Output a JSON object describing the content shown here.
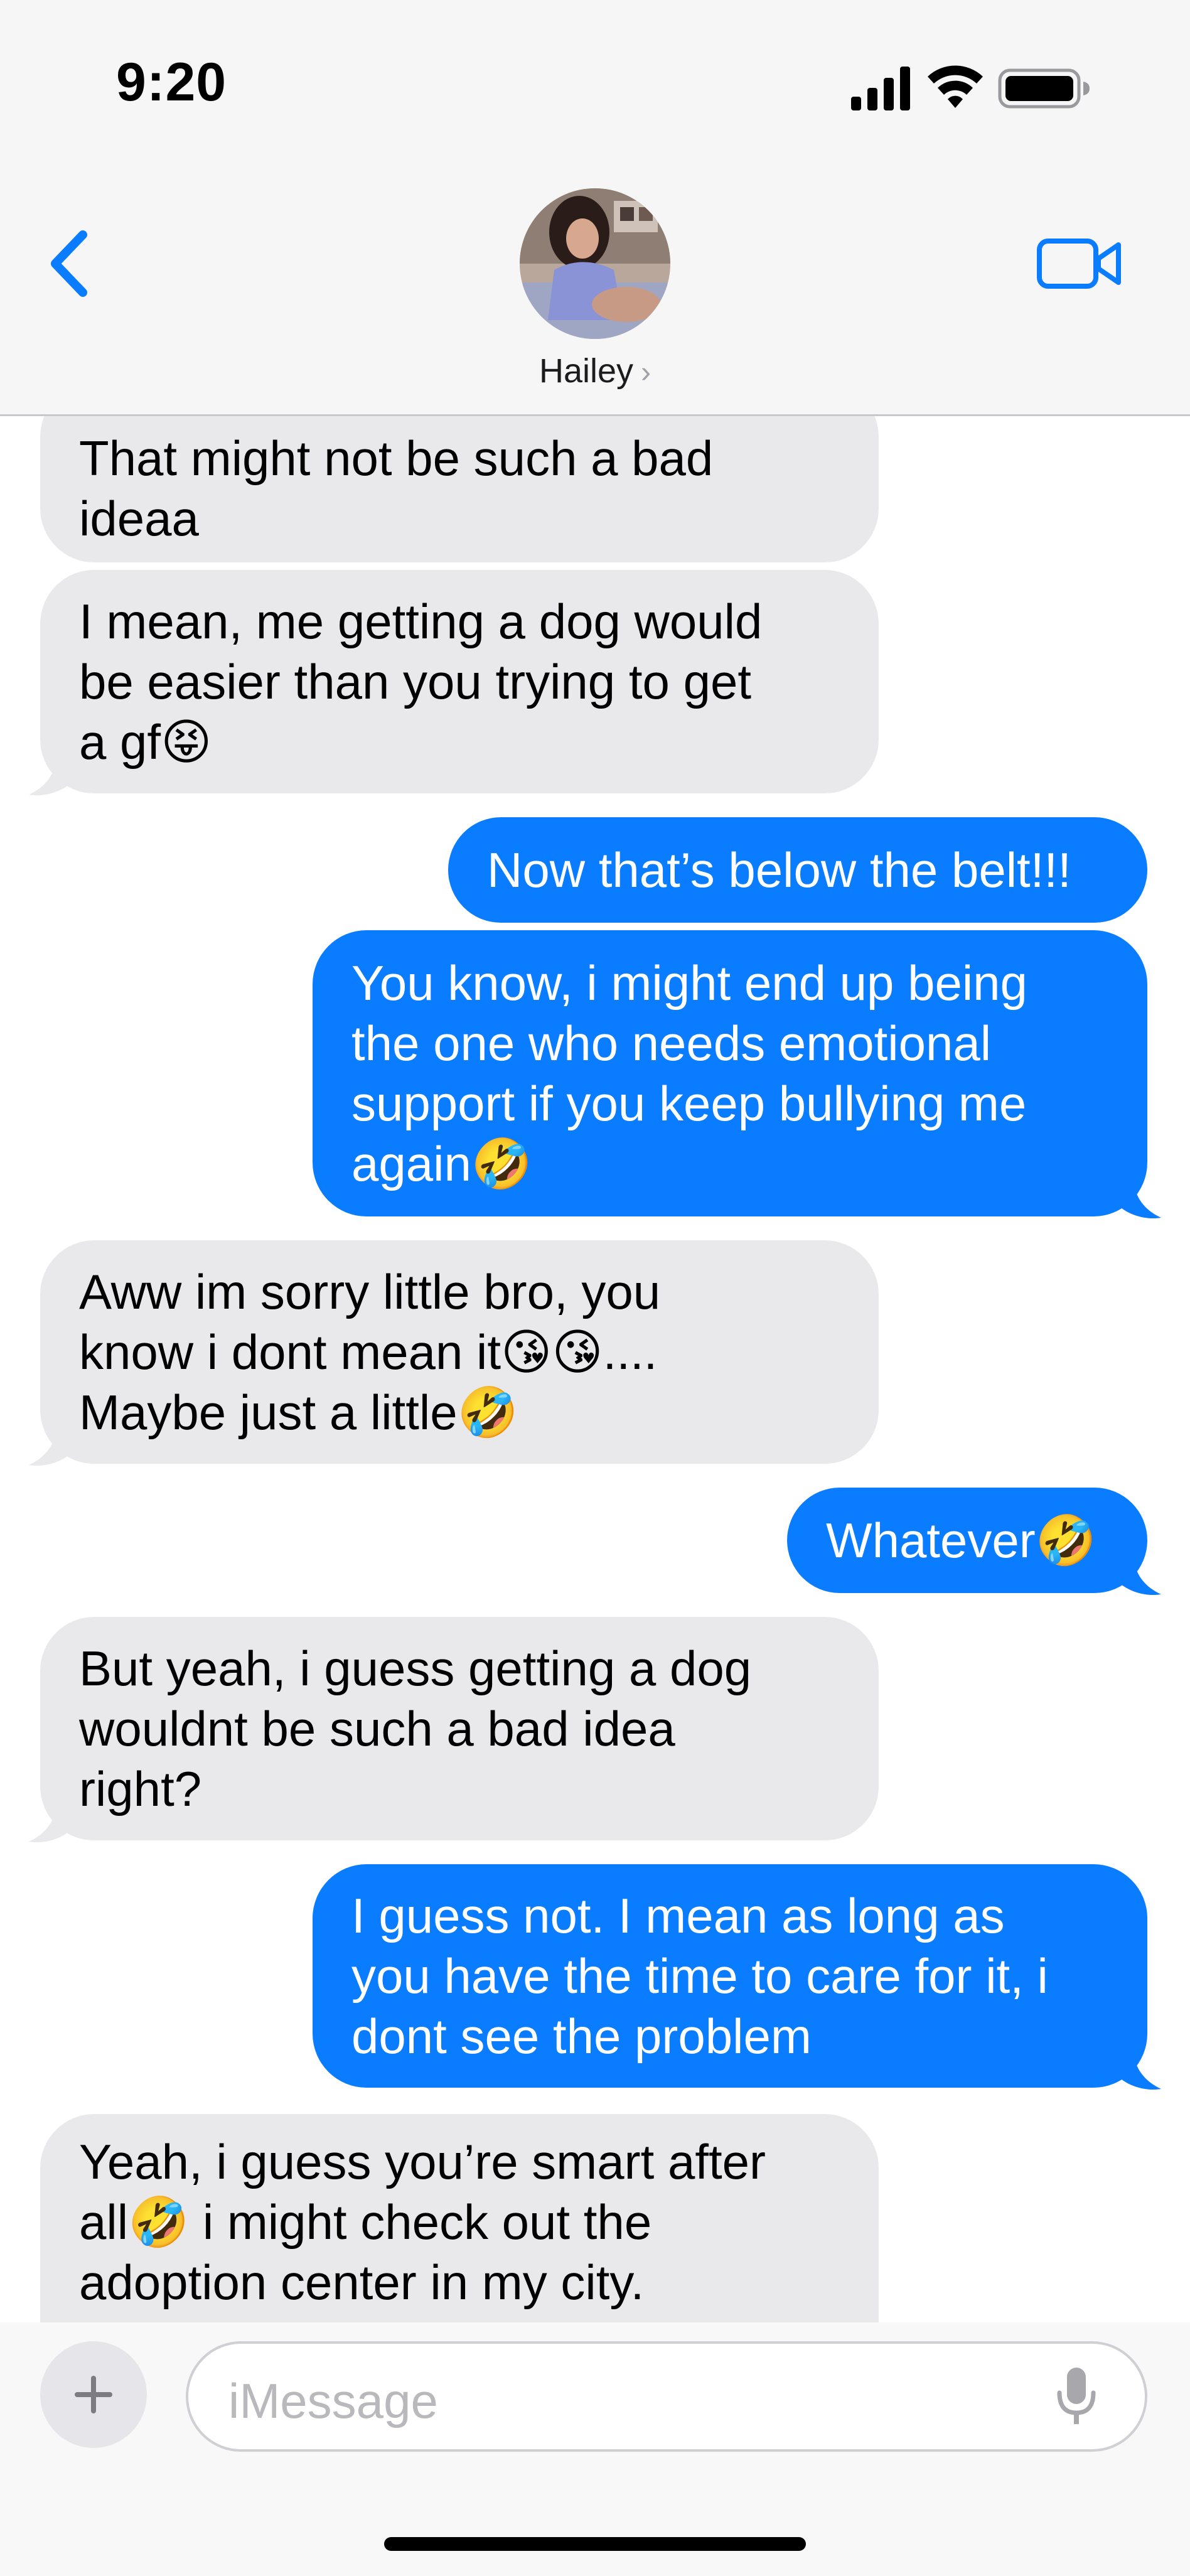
{
  "status_bar": {
    "time": "9:20"
  },
  "header": {
    "contact_name": "Hailey",
    "chevron": "›",
    "back_icon": "chevron-left-icon",
    "video_icon": "video-camera-icon",
    "accent_color": "#0a7cff"
  },
  "messages": [
    {
      "side": "in",
      "lines": [
        "That might not be such a bad",
        "ideaa"
      ]
    },
    {
      "side": "in",
      "lines": [
        "I mean, me getting a dog would",
        "be easier than you trying to get",
        "a gf😝"
      ]
    },
    {
      "side": "out",
      "lines": [
        "Now that’s below the belt!!!"
      ]
    },
    {
      "side": "out",
      "lines": [
        "You know, i might end up being",
        "the one who needs emotional",
        "support if you keep bullying me",
        "again🤣"
      ]
    },
    {
      "side": "in",
      "lines": [
        "Aww im sorry little bro, you",
        "know i dont mean it😘😘....",
        "Maybe just a little🤣"
      ]
    },
    {
      "side": "out",
      "lines": [
        "Whatever🤣"
      ]
    },
    {
      "side": "in",
      "lines": [
        "But yeah, i guess getting a dog",
        "wouldnt be such a bad idea",
        "right?"
      ]
    },
    {
      "side": "out",
      "lines": [
        "I guess not. I mean as long as",
        "you have the time to care for it, i",
        "dont see the problem"
      ]
    },
    {
      "side": "in",
      "lines": [
        "Yeah, i guess you’re smart after",
        "all🤣 i might check out the",
        "adoption center in my city."
      ]
    }
  ],
  "composer": {
    "placeholder": "iMessage",
    "plus_icon": "plus-icon",
    "mic_icon": "microphone-icon"
  },
  "colors": {
    "incoming_bubble": "#e9e9eb",
    "outgoing_bubble": "#0a7cff"
  }
}
